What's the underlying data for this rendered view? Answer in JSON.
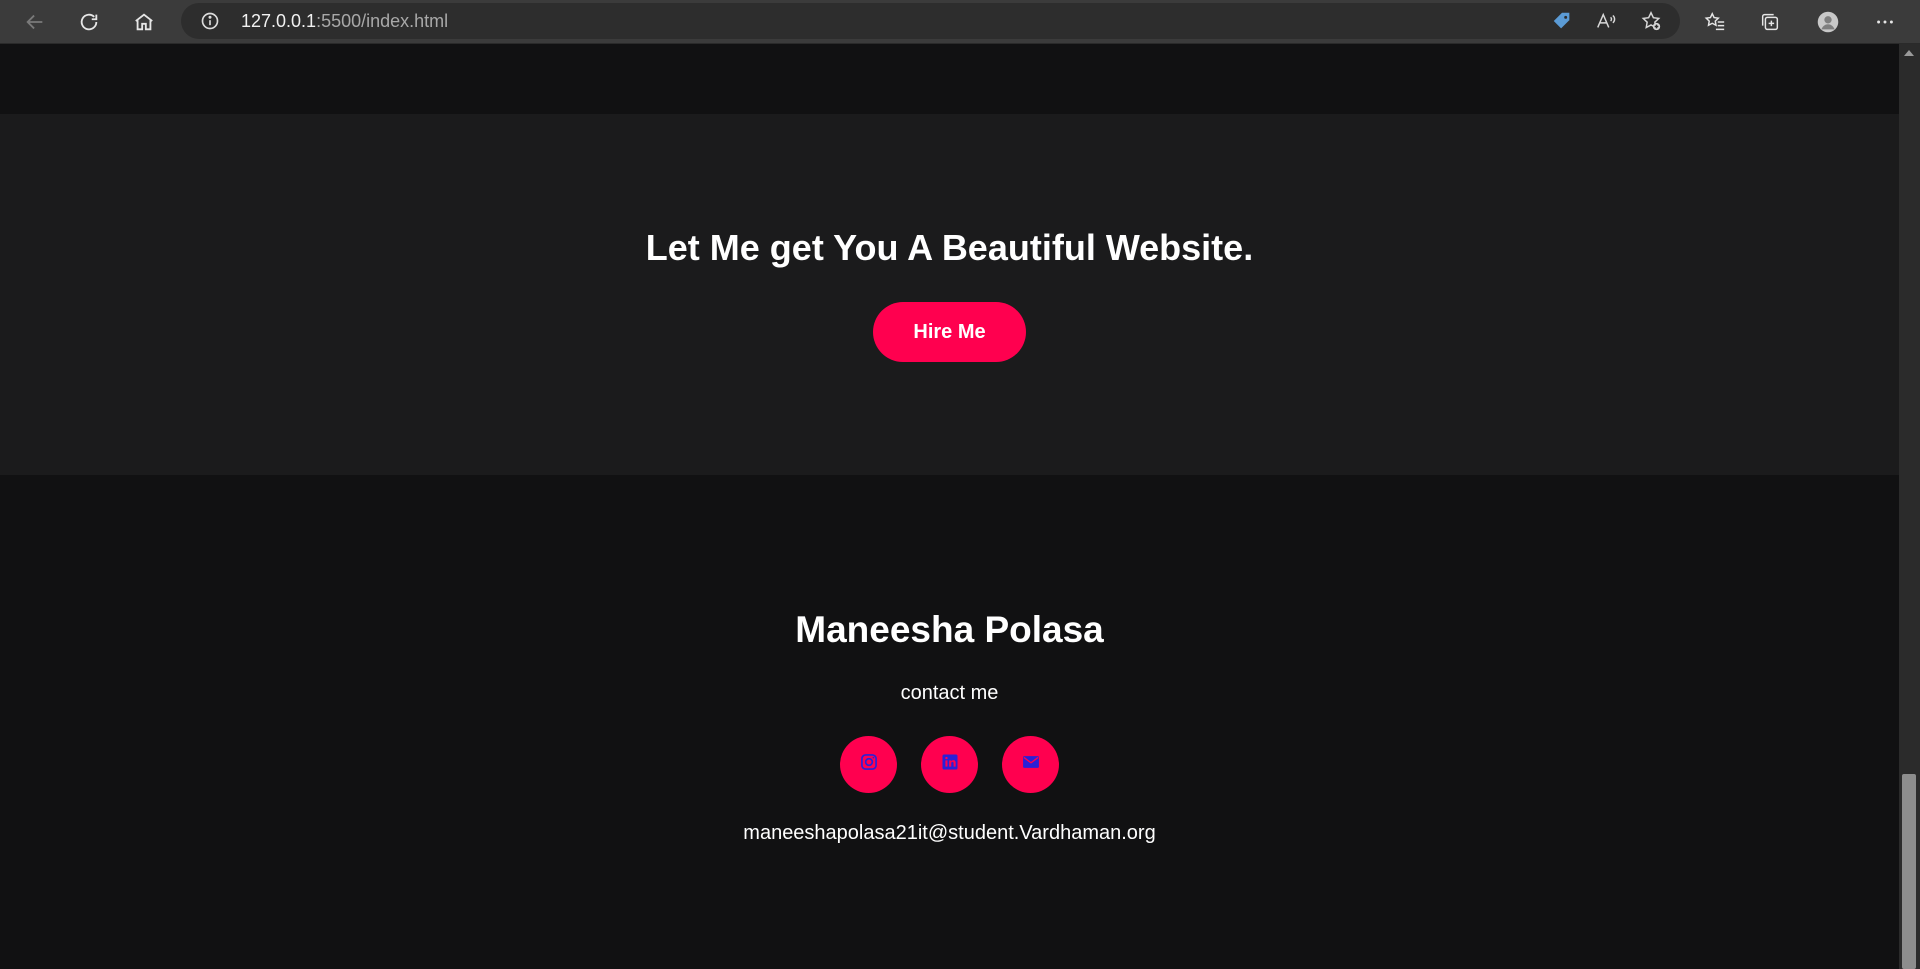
{
  "browser": {
    "url_host": "127.0.0.1",
    "url_rest": ":5500/index.html",
    "icons": {
      "back": "back-arrow-icon",
      "refresh": "refresh-icon",
      "home": "home-icon",
      "info": "info-icon",
      "tag": "tag-icon",
      "read_aloud": "read-aloud-icon",
      "add_favorite": "add-favorite-icon",
      "favorites": "favorites-icon",
      "collections": "collections-icon",
      "profile": "profile-avatar-icon",
      "menu": "more-menu-icon"
    }
  },
  "hire": {
    "title": "Let Me get You A Beautiful Website.",
    "button_label": "Hire Me"
  },
  "footer": {
    "name": "Maneesha Polasa",
    "contact_label": "contact me",
    "email": "maneeshapolasa21it@student.Vardhaman.org",
    "social": [
      {
        "icon": "instagram-icon"
      },
      {
        "icon": "linkedin-icon"
      },
      {
        "icon": "email-icon"
      }
    ]
  },
  "colors": {
    "accent": "#ff004f",
    "page_bg": "#111112",
    "section_bg": "#1b1b1c",
    "social_icon": "#2a20d6"
  }
}
